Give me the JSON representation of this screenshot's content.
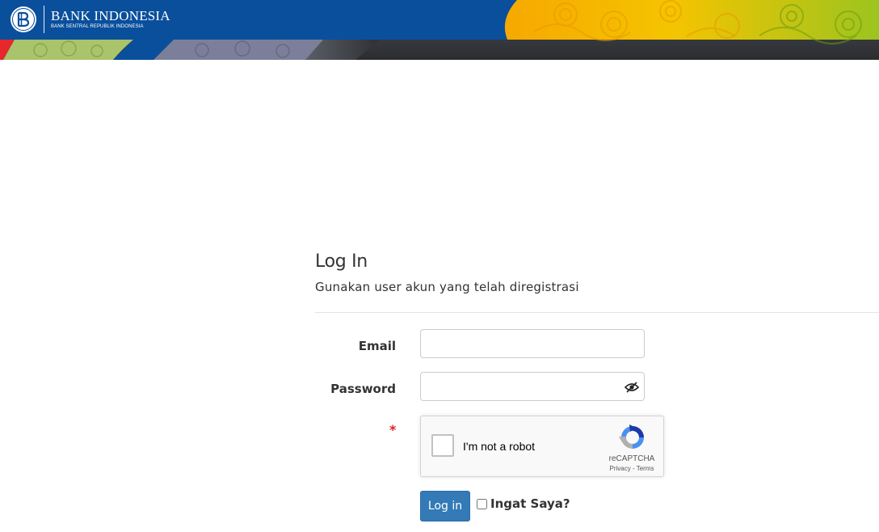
{
  "header": {
    "brand_title": "BANK INDONESIA",
    "brand_subtitle": "BANK SENTRAL REPUBLIK INDONESIA",
    "colors": {
      "primary_blue": "#0a4f9c",
      "dark_band": "#2e3034",
      "accent_yellow": "#f7b500",
      "accent_green": "#8dbd2a"
    }
  },
  "login": {
    "title": "Log In",
    "subtitle": "Gunakan user akun yang telah diregistrasi",
    "email_label": "Email",
    "email_value": "",
    "password_label": "Password",
    "password_value": "",
    "required_marker": "*",
    "submit_label": "Log in",
    "remember_label": "Ingat Saya?",
    "remember_checked": false,
    "button_color": "#337ab7"
  },
  "recaptcha": {
    "label": "I'm not a robot",
    "brand": "reCAPTCHA",
    "privacy": "Privacy",
    "separator": " - ",
    "terms": "Terms"
  },
  "icons": {
    "seal": "bank-indonesia-seal-icon",
    "password_toggle": "eye-slash-icon",
    "recaptcha": "recaptcha-logo-icon"
  }
}
